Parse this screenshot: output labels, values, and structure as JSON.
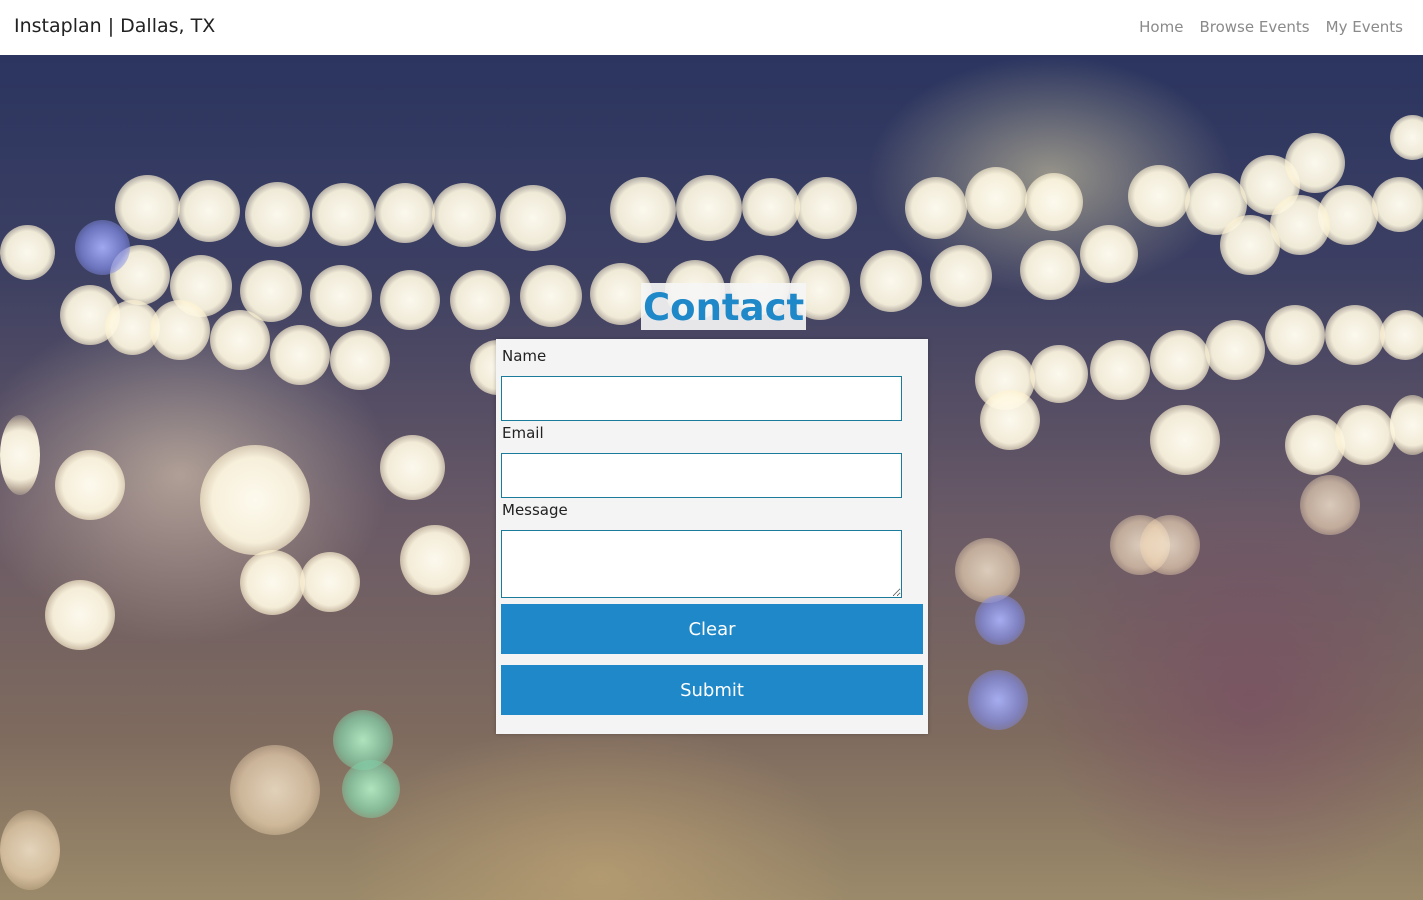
{
  "navbar": {
    "brand": "Instaplan | Dallas, TX",
    "links": [
      "Home",
      "Browse Events",
      "My Events"
    ]
  },
  "contact": {
    "title": "Contact",
    "fields": {
      "name_label": "Name",
      "name_value": "",
      "email_label": "Email",
      "email_value": "",
      "message_label": "Message",
      "message_value": ""
    },
    "buttons": {
      "clear": "Clear",
      "submit": "Submit"
    }
  },
  "colors": {
    "accent": "#1e88c8",
    "input_border": "#1b7b9a",
    "card_background": "#f4f4f4"
  }
}
